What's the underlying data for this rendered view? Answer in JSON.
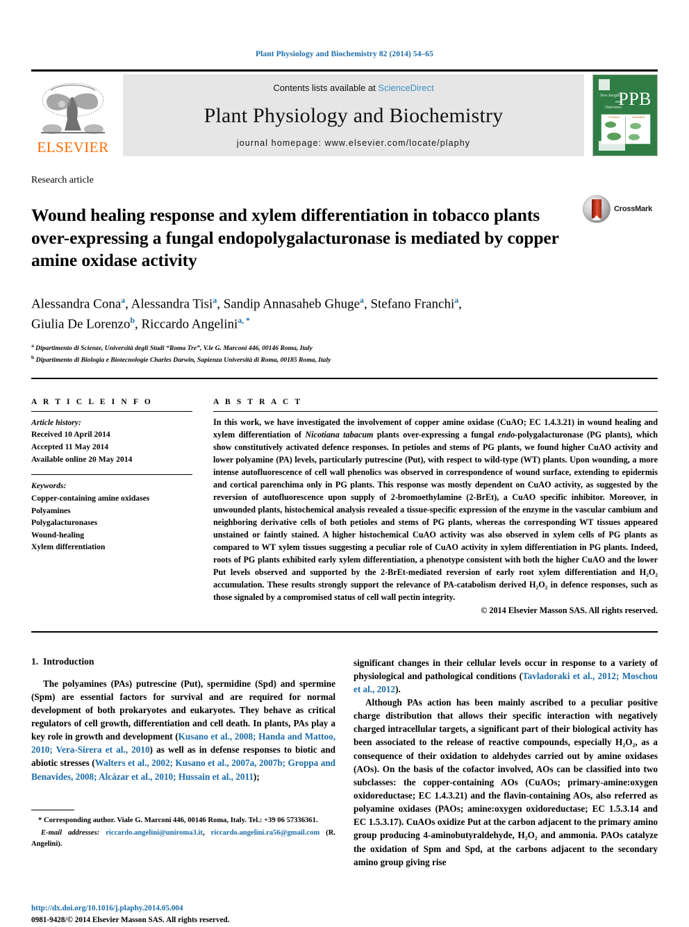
{
  "running_head": "Plant Physiology and Biochemistry 82 (2014) 54–65",
  "header": {
    "contents_prefix": "Contents lists available at",
    "sciencedirect": "ScienceDirect",
    "journal_name": "Plant Physiology and Biochemistry",
    "homepage": "journal homepage: www.elsevier.com/locate/plaphy",
    "publisher_logo_text": "ELSEVIER",
    "cover_title": "PPB",
    "cover_subtitle": "New Insights and Outcomes",
    "cover_panel_left_label": "Functions",
    "cover_panel_right_label": "Interactions",
    "band_color": "#e6e6e6",
    "cover_color": "#2f7d44",
    "elsevier_color": "#ff6c00",
    "link_color": "#3a8fc8"
  },
  "article": {
    "type": "Research article",
    "title": "Wound healing response and xylem differentiation in tobacco plants over-expressing a fungal endopolygalacturonase is mediated by copper amine oxidase activity",
    "crossmark_label": "CrossMark",
    "authors": [
      {
        "name": "Alessandra Cona",
        "marks": "a",
        "sep": ", "
      },
      {
        "name": "Alessandra Tisi",
        "marks": "a",
        "sep": ", "
      },
      {
        "name": "Sandip Annasaheb Ghuge",
        "marks": "a",
        "sep": ", "
      },
      {
        "name": "Stefano Franchi",
        "marks": "a",
        "sep": ", "
      },
      {
        "name": "Giulia De Lorenzo",
        "marks": "b",
        "sep": ", "
      },
      {
        "name": "Riccardo Angelini",
        "marks": "a, *",
        "sep": ""
      }
    ],
    "affiliations": [
      {
        "mark": "a",
        "text": "Dipartimento di Scienze, Università degli Studi “Roma Tre”, V.le G. Marconi 446, 00146 Roma, Italy"
      },
      {
        "mark": "b",
        "text": "Dipartimento di Biologia e Biotecnologie Charles Darwin, Sapienza Università di Roma, 00185 Roma, Italy"
      }
    ]
  },
  "article_info": {
    "heading": "A R T I C L E  I N F O",
    "history_label": "Article history:",
    "history": [
      "Received 10 April 2014",
      "Accepted 11 May 2014",
      "Available online 20 May 2014"
    ],
    "keywords_label": "Keywords:",
    "keywords": [
      "Copper-containing amine oxidases",
      "Polyamines",
      "Polygalacturonases",
      "Wound-healing",
      "Xylem differentiation"
    ]
  },
  "abstract": {
    "heading": "A B S T R A C T",
    "paragraph_1": "In this work, we have investigated the involvement of copper amine oxidase (CuAO; EC 1.4.3.21) in wound healing and xylem differentiation of ",
    "italic_1": "Nicotiana tabacum",
    "paragraph_2": " plants over-expressing a fungal ",
    "italic_2": "endo-",
    "paragraph_3": "polygalacturonase (PG plants), which show constitutively activated defence responses. In petioles and stems of PG plants, we found higher CuAO activity and lower polyamine (PA) levels, particularly putrescine (Put), with respect to wild-type (WT) plants. Upon wounding, a more intense autofluorescence of cell wall phenolics was observed in correspondence of wound surface, extending to epidermis and cortical parenchima only in PG plants. This response was mostly dependent on CuAO activity, as suggested by the reversion of autofluorescence upon supply of 2-bromoethylamine (2-BrEt), a CuAO specific inhibitor. Moreover, in unwounded plants, histochemical analysis revealed a tissue-specific expression of the enzyme in the vascular cambium and neighboring derivative cells of both petioles and stems of PG plants, whereas the corresponding WT tissues appeared unstained or faintly stained. A higher histochemical CuAO activity was also observed in xylem cells of PG plants as compared to WT xylem tissues suggesting a peculiar role of CuAO activity in xylem differentiation in PG plants. Indeed, roots of PG plants exhibited early xylem differentiation, a phenotype consistent with both the higher CuAO and the lower Put levels observed and supported by the 2-BrEt-mediated reversion of early root xylem differentiation and H₂O₂ accumulation. These results strongly support the relevance of PA-catabolism derived H₂O₂ in defence responses, such as those signaled by a compromised status of cell wall pectin integrity.",
    "copyright": "© 2014 Elsevier Masson SAS. All rights reserved."
  },
  "body": {
    "section_number": "1.",
    "section_title": "Introduction",
    "left_para_1_a": "The polyamines (PAs) putrescine (Put), spermidine (Spd) and spermine (Spm) are essential factors for survival and are required for normal development of both prokaryotes and eukaryotes. They behave as critical regulators of cell growth, differentiation and cell death. In plants, PAs play a key role in growth and development (",
    "left_cite_1": "Kusano et al., 2008; Handa and Mattoo, 2010; Vera-Sirera et al., 2010",
    "left_para_1_b": ") as well as in defense responses to biotic and abiotic stresses (",
    "left_cite_2": "Walters et al., 2002; Kusano et al., 2007a, 2007b; Groppa and Benavides, 2008; Alcázar et al., 2010; Hussain et al., 2011",
    "left_para_1_c": ");",
    "right_para_1_a": "significant changes in their cellular levels occur in response to a variety of physiological and pathological conditions (",
    "right_cite_1": "Tavladoraki et al., 2012; Moschou et al., 2012",
    "right_para_1_b": ").",
    "right_para_2": "Although PAs action has been mainly ascribed to a peculiar positive charge distribution that allows their specific interaction with negatively charged intracellular targets, a significant part of their biological activity has been associated to the release of reactive compounds, especially H₂O₂, as a consequence of their oxidation to aldehydes carried out by amine oxidases (AOs). On the basis of the cofactor involved, AOs can be classified into two subclasses: the copper-containing AOs (CuAOs; primary-amine:oxygen oxidoreductase; EC 1.4.3.21) and the flavin-containing AOs, also referred as polyamine oxidases (PAOs; amine:oxygen oxidoreductase; EC 1.5.3.14 and EC 1.5.3.17). CuAOs oxidize Put at the carbon adjacent to the primary amino group producing 4-aminobutyraldehyde, H₂O₂ and ammonia. PAOs catalyze the oxidation of Spm and Spd, at the carbons adjacent to the secondary amino group giving rise"
  },
  "footnotes": {
    "corresponding_mark": "*",
    "corresponding": "Corresponding author. Viale G. Marconi 446, 00146 Roma, Italy. Tel.: +39 06 57336361.",
    "email_label": "E-mail addresses:",
    "email_1": "riccardo.angelini@uniroma3.it",
    "email_sep": ", ",
    "email_2": "riccardo.angelini.ra56@gmail.com",
    "email_suffix": " (R. Angelini)."
  },
  "footer": {
    "doi": "http://dx.doi.org/10.1016/j.plaphy.2014.05.004",
    "issn_line": "0981-9428/© 2014 Elsevier Masson SAS. All rights reserved."
  }
}
